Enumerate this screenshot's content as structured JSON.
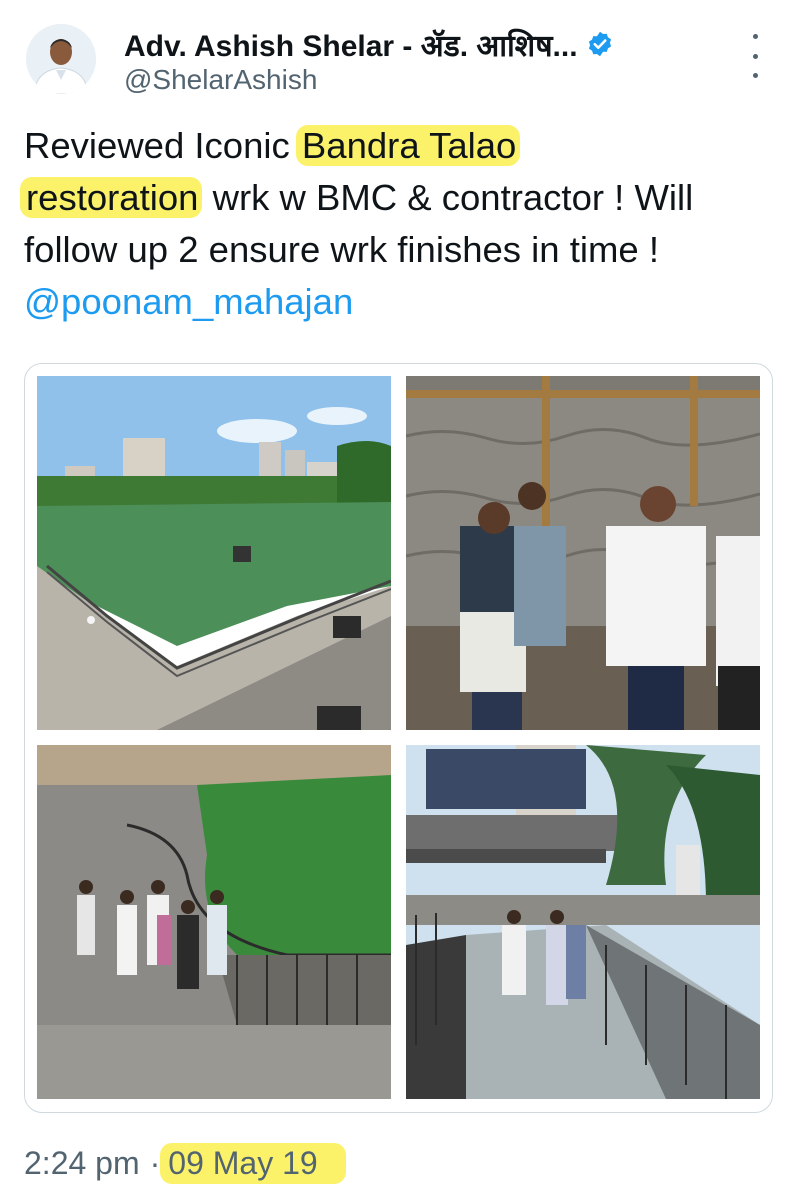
{
  "author": {
    "display_name": "Adv. Ashish Shelar - ॲड. आशिष...",
    "handle": "@ShelarAshish",
    "avatar_icon": "user-avatar",
    "verified_icon": "verified-badge-icon",
    "verified_color": "#1d9bf0"
  },
  "tweet": {
    "segments": [
      {
        "text": "Reviewed Iconic ",
        "style": "plain"
      },
      {
        "text": "Bandra Talao",
        "style": "highlight"
      },
      {
        "text": "restoration",
        "style": "highlight"
      },
      {
        "text": " wrk w BMC & contractor ! Will follow up 2 ensure wrk finishes in time ! ",
        "style": "plain"
      },
      {
        "text": "@poonam_mahajan",
        "style": "mention"
      }
    ],
    "highlight_color": "#fbf26a",
    "mention_color": "#1d9bf0"
  },
  "media": {
    "photos": [
      {
        "name": "lake-overview-photo"
      },
      {
        "name": "officials-inspection-photo"
      },
      {
        "name": "lakeside-walk-photo"
      },
      {
        "name": "skywalk-bridge-photo"
      }
    ]
  },
  "footer": {
    "time": "2:24 pm",
    "separator": "·",
    "date": "09 May 19"
  },
  "menu_icon": "more-options-icon"
}
